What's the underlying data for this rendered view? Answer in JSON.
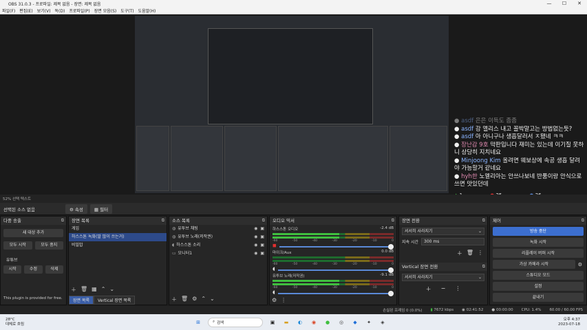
{
  "window": {
    "title": "OBS 31.0.3 - 프로파일: 제목 없음 - 장면: 제목 없음",
    "minimize": "—",
    "maximize": "☐",
    "close": "✕"
  },
  "menu": [
    "파일(F)",
    "편집(E)",
    "보기(V)",
    "독(D)",
    "프로파일(P)",
    "장면 모음(S)",
    "도구(T)",
    "도움말(H)"
  ],
  "preview_status": "52%  선택 텍스트",
  "chat": {
    "lines": [
      {
        "name": "asdf",
        "text": "은은 이득도 좀좀"
      },
      {
        "name": "asdf",
        "text": "강 엘리스 내고 꼴박말고는 방법없는듯?"
      },
      {
        "name": "asdf",
        "text": "아 아니구나 생흡달러서 ㅈ됐네 ㅋㅋ"
      },
      {
        "name": "장난감 9호",
        "text": "막판입니다 재미는 있는데 이기질 못하니 상당히 지치네요"
      },
      {
        "name": "Minjoong Kim",
        "text": "올려면 웨보상에 속공 생흡 달려 야 가능할거 같네요"
      },
      {
        "name": "hyh한",
        "text": "노멜리아는 안쓰나보네 반품이랑 안식으로 쓰면 맛있던데"
      }
    ],
    "stats": [
      "1",
      "25",
      "26"
    ]
  },
  "source_bar": {
    "label": "선택된 소스 없음",
    "props": "속성",
    "filters": "필터"
  },
  "scene_transition_dock": {
    "title": "다중 송출",
    "add": "새 대상 추가",
    "start_all": "모두 시작",
    "stop_all": "모두 중지",
    "youtube": "유튜브",
    "start": "시작",
    "edit": "수정",
    "delete": "삭제",
    "note": "This plugin is provided for free."
  },
  "scenes": {
    "title": "장면 목록",
    "items": [
      "게임",
      "하스스톤 녹화(말 많이 쓰는거)",
      "비밀밥"
    ],
    "tab_scene": "장면 목록",
    "tab_vertical": "Vertical 장면 목록"
  },
  "sources": {
    "title": "소스 목록",
    "items": [
      "유투브 채팅",
      "유투브 노래(저작권)",
      "하스스톤 소리",
      "모니터1"
    ]
  },
  "mixer": {
    "title": "오디오 믹서",
    "channels": [
      {
        "name": "하스스톤 오디오",
        "db": "-2.4 dB"
      },
      {
        "name": "마이크/Aux",
        "db": "0.0 dB"
      },
      {
        "name": "유투브 노래(저작권)",
        "db": "-9.1 dB"
      }
    ],
    "scale": [
      "-60",
      "-55",
      "-50",
      "-45",
      "-40",
      "-35",
      "-30",
      "-25",
      "-20",
      "-15",
      "-10",
      "-5",
      "0"
    ]
  },
  "transitions": {
    "title": "장면 전환",
    "effect": "서서히 사라지기",
    "duration_label": "지속 시간",
    "duration": "300 ms",
    "vertical_title": "Vertical 장면 전환",
    "vertical_effect": "서서히 사라지기"
  },
  "controls": {
    "title": "제어",
    "stop_stream": "방송 중단",
    "start_record": "녹화 시작",
    "replay_buffer": "리플레이 버퍼 시작",
    "virtual_cam": "가상 카메라 시작",
    "studio_mode": "스튜디오 모드",
    "settings": "설정",
    "exit": "끝내기"
  },
  "obs_status": {
    "frames": "손실된 프레임 0 (0.0%)",
    "bitrate": "7672 kbps",
    "live_time": "02:41:52",
    "rec_time": "00:00:00",
    "cpu": "CPU: 1.4%",
    "fps": "60.00 / 60.00 FPS"
  },
  "taskbar": {
    "temp": "28°C",
    "weather": "대체로 흐림",
    "search": "검색",
    "time": "오후 4:37",
    "date": "2023-07-18"
  }
}
